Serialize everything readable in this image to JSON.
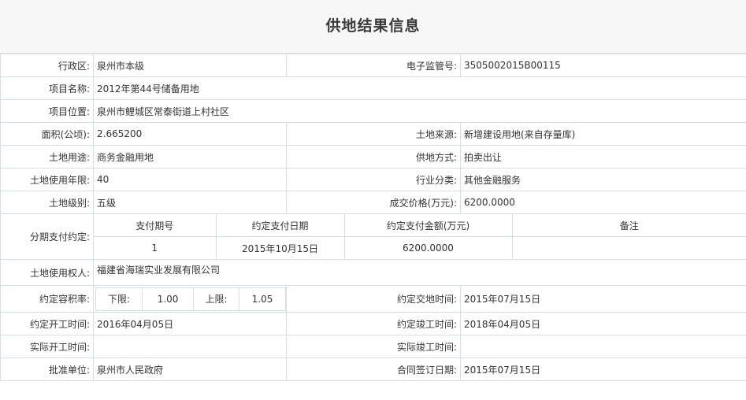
{
  "title": "供地结果信息",
  "fields": {
    "district_label": "行政区:",
    "district": "泉州市本级",
    "supervision_label": "电子监管号:",
    "supervision": "3505002015B00115",
    "project_name_label": "项目名称:",
    "project_name": "2012年第44号储备用地",
    "project_location_label": "项目位置:",
    "project_location": "泉州市鲤城区常泰街道上村社区",
    "area_label": "面积(公顷):",
    "area": "2.665200",
    "land_source_label": "土地来源:",
    "land_source": "新增建设用地(来自存量库)",
    "land_use_label": "土地用途:",
    "land_use": "商务金融用地",
    "supply_method_label": "供地方式:",
    "supply_method": "拍卖出让",
    "use_years_label": "土地使用年限:",
    "use_years": "40",
    "industry_label": "行业分类:",
    "industry": "其他金融服务",
    "land_level_label": "土地级别:",
    "land_level": "五级",
    "price_label": "成交价格(万元):",
    "price": "6200.0000",
    "installment_label": "分期支付约定:",
    "installment_headers": [
      "支付期号",
      "约定支付日期",
      "约定支付金额(万元)",
      "备注"
    ],
    "installment_rows": [
      [
        "1",
        "2015年10月15日",
        "6200.0000",
        ""
      ]
    ],
    "owner_label": "土地使用权人:",
    "owner": "福建省海瑞实业发展有限公司",
    "far_label": "约定容积率:",
    "far_lower_label": "下限:",
    "far_lower": "1.00",
    "far_upper_label": "上限:",
    "far_upper": "1.05",
    "delivery_time_label": "约定交地时间:",
    "delivery_time": "2015年07月15日",
    "start_time_label": "约定开工时间:",
    "start_time": "2016年04月05日",
    "finish_time_label": "约定竣工时间:",
    "finish_time": "2018年04月05日",
    "actual_start_label": "实际开工时间:",
    "actual_start": "",
    "actual_finish_label": "实际竣工时间:",
    "actual_finish": "",
    "approval_unit_label": "批准单位:",
    "approval_unit": "泉州市人民政府",
    "contract_date_label": "合同签订日期:",
    "contract_date": "2015年07月15日"
  }
}
